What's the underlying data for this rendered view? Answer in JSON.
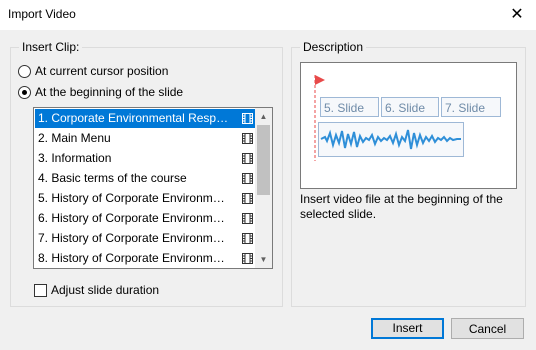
{
  "window": {
    "title": "Import Video",
    "close_glyph": "✕"
  },
  "insert_clip": {
    "legend": "Insert Clip:",
    "options": [
      {
        "label": "At current cursor position",
        "selected": false
      },
      {
        "label": "At the beginning of the slide",
        "selected": true
      }
    ],
    "slides": [
      "1. Corporate Environmental Responsi...",
      "2. Main Menu",
      "3. Information",
      "4. Basic terms of the course",
      "5. History of Corporate Environmental...",
      "6. History of Corporate Environmental...",
      "7. History of Corporate Environmental...",
      "8. History of Corporate Environmental..."
    ],
    "selected_index": 0,
    "item_icon": "film-icon",
    "adjust_label": "Adjust slide duration",
    "adjust_checked": false
  },
  "description": {
    "legend": "Description",
    "preview_slides": [
      "5. Slide",
      "6. Slide",
      "7. Slide"
    ],
    "text": "Insert video file at the beginning of the selected slide."
  },
  "buttons": {
    "insert": "Insert",
    "cancel": "Cancel"
  },
  "colors": {
    "selection": "#0078d7",
    "marker": "#e84a4a",
    "wave": "#2f8fd8"
  }
}
